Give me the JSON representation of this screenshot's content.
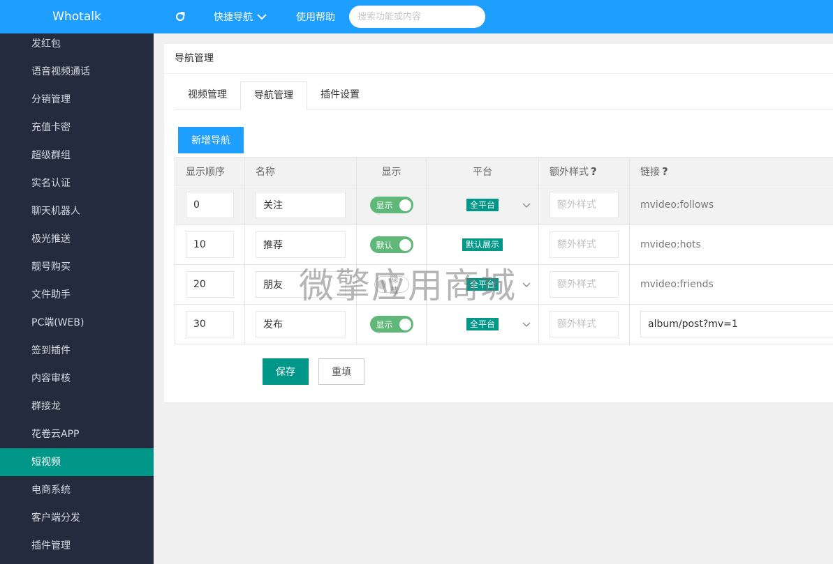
{
  "app": {
    "title": "Whotalk"
  },
  "sidebar": {
    "items": [
      {
        "label": "发红包"
      },
      {
        "label": "语音视频通话"
      },
      {
        "label": "分销管理"
      },
      {
        "label": "充值卡密"
      },
      {
        "label": "超级群组"
      },
      {
        "label": "实名认证"
      },
      {
        "label": "聊天机器人"
      },
      {
        "label": "极光推送"
      },
      {
        "label": "靓号购买"
      },
      {
        "label": "文件助手"
      },
      {
        "label": "PC端(WEB)"
      },
      {
        "label": "签到插件"
      },
      {
        "label": "内容审核"
      },
      {
        "label": "群接龙"
      },
      {
        "label": "花卷云APP"
      },
      {
        "label": "短视频",
        "active": true
      },
      {
        "label": "电商系统"
      },
      {
        "label": "客户端分发"
      },
      {
        "label": "插件管理"
      }
    ]
  },
  "topbar": {
    "refresh_icon": "refresh-icon",
    "quick_nav": "快捷导航",
    "help": "使用帮助",
    "search_placeholder": "搜索功能或内容"
  },
  "card": {
    "title": "导航管理",
    "tabs": [
      {
        "label": "视频管理"
      },
      {
        "label": "导航管理",
        "active": true
      },
      {
        "label": "插件设置"
      }
    ],
    "add_button": "新增导航",
    "table": {
      "headers": {
        "order": "显示顺序",
        "name": "名称",
        "show": "显示",
        "platform": "平台",
        "style": "额外样式",
        "link": "链接"
      },
      "rows": [
        {
          "order": "0",
          "name": "关注",
          "show": "显示",
          "show_on": true,
          "platform": "全平台",
          "platform_select": true,
          "style_placeholder": "额外样式",
          "link": "mvideo:follows",
          "link_editable": false
        },
        {
          "order": "10",
          "name": "推荐",
          "show": "默认",
          "show_on": true,
          "platform": "默认展示",
          "platform_select": false,
          "style_placeholder": "额外样式",
          "link": "mvideo:hots",
          "link_editable": false
        },
        {
          "order": "20",
          "name": "朋友",
          "show": "隐藏",
          "show_on": false,
          "platform": "全平台",
          "platform_select": true,
          "style_placeholder": "额外样式",
          "link": "mvideo:friends",
          "link_editable": false
        },
        {
          "order": "30",
          "name": "发布",
          "show": "显示",
          "show_on": true,
          "platform": "全平台",
          "platform_select": true,
          "style_placeholder": "额外样式",
          "link": "album/post?mv=1",
          "link_editable": true
        }
      ]
    },
    "save_button": "保存",
    "reset_button": "重填"
  },
  "watermark": "微擎应用商城",
  "colors": {
    "primary_blue": "#1e9fff",
    "sidebar_bg": "#232b3c",
    "teal": "#009688",
    "switch_green": "#5fb878"
  }
}
